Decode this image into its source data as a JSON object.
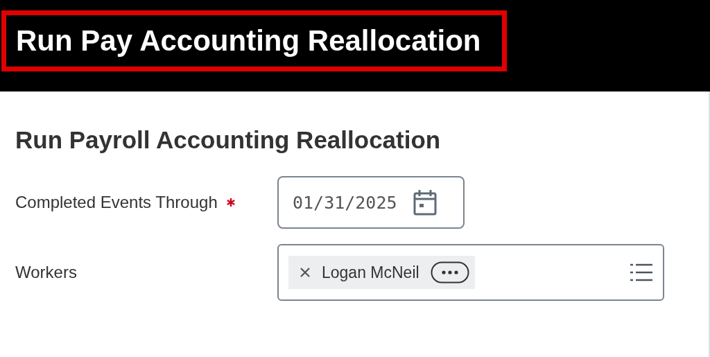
{
  "header": {
    "title": "Run Pay Accounting Reallocation",
    "highlighted": true
  },
  "form": {
    "title": "Run Payroll Accounting Reallocation",
    "fields": [
      {
        "kind": "date",
        "label": "Completed Events Through",
        "required": true,
        "value": "01/31/2025"
      },
      {
        "kind": "multiselect",
        "label": "Workers",
        "required": false,
        "tokens": [
          {
            "label": "Logan McNeil"
          }
        ]
      }
    ]
  }
}
